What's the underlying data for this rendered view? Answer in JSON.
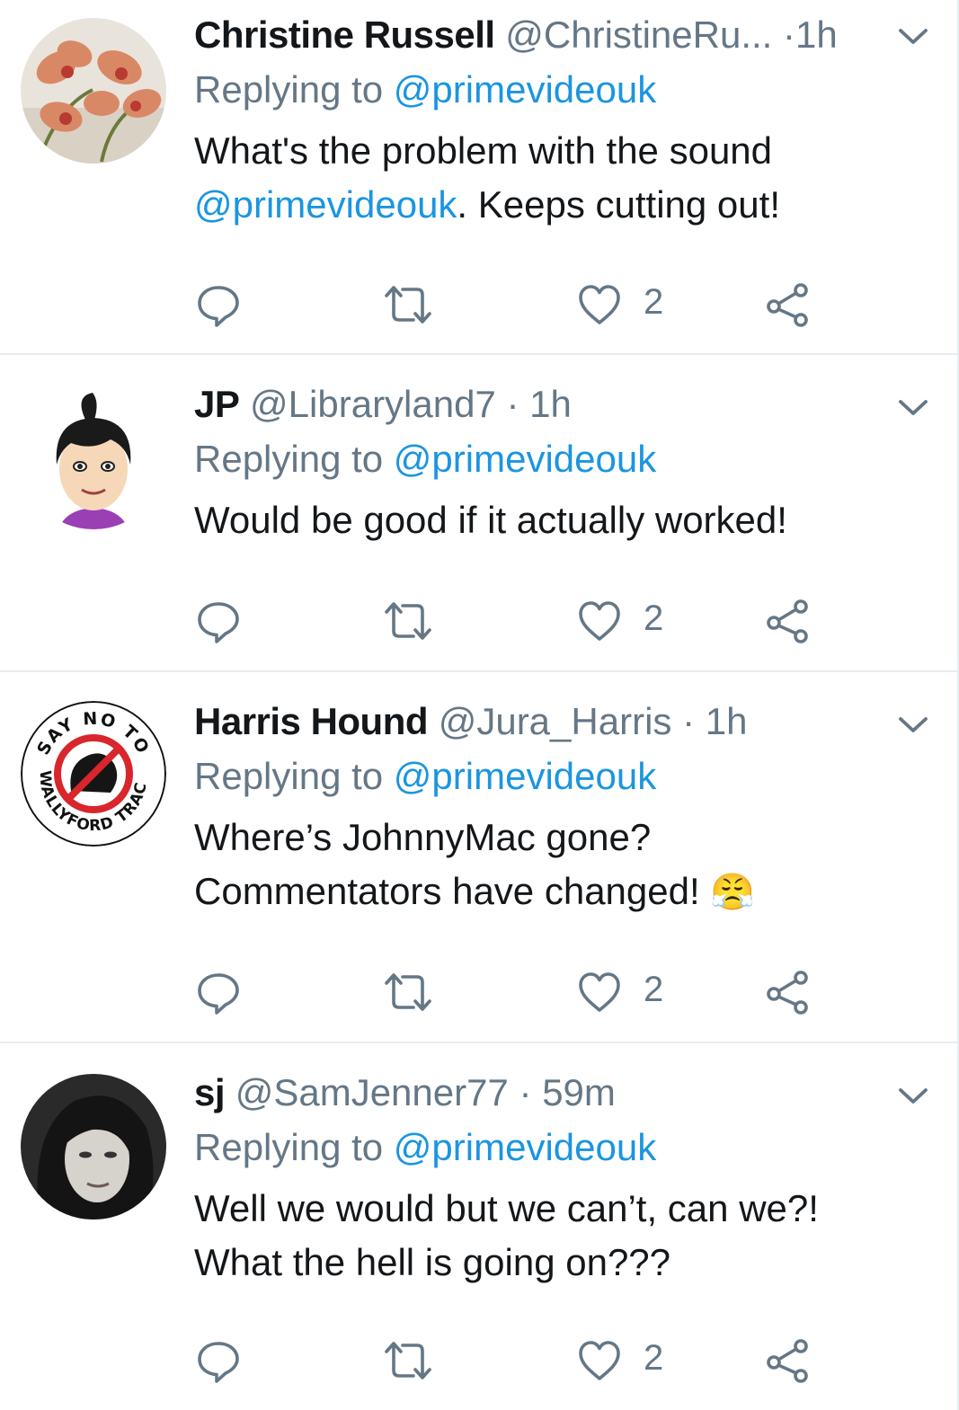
{
  "reply_prefix": "Replying to",
  "tweets": [
    {
      "name": "Christine Russell",
      "handle": "@ChristineRu...",
      "sep": "·",
      "time": "1h",
      "reply_to": "@primevideouk",
      "text_1": "What's the problem with the sound",
      "mention_2": "@primevideouk",
      "text_2": ". Keeps cutting out!",
      "likes": "2",
      "avatar_icon": "orchid-flowers-avatar"
    },
    {
      "name": "JP",
      "handle": "@Libraryland7",
      "sep": "·",
      "time": "1h",
      "reply_to": "@primevideouk",
      "text_1": "Would be good if it actually worked!",
      "likes": "2",
      "avatar_icon": "cartoon-girl-avatar"
    },
    {
      "name": "Harris Hound",
      "handle": "@Jura_Harris",
      "sep": "·",
      "time": "1h",
      "reply_to": "@primevideouk",
      "text_1": "Where’s JohnnyMac gone?",
      "text_2": "Commentators have changed!",
      "emoji": "😤",
      "likes": "2",
      "avatar_icon": "say-no-to-wallyford-track-badge",
      "badge_top": "SAY NO TO",
      "badge_bottom": "WALLYFORD TRACK"
    },
    {
      "name": "sj",
      "handle": "@SamJenner77",
      "sep": "·",
      "time": "59m",
      "reply_to": "@primevideouk",
      "text_1": "Well we would but we can’t, can we?!",
      "text_2": "What the hell is going on???",
      "likes": "2",
      "avatar_icon": "woman-portrait-bw-avatar"
    }
  ],
  "colors": {
    "link": "#1b95e0",
    "secondary": "#657786",
    "text": "#14171a",
    "divider": "#e6ecf0"
  }
}
